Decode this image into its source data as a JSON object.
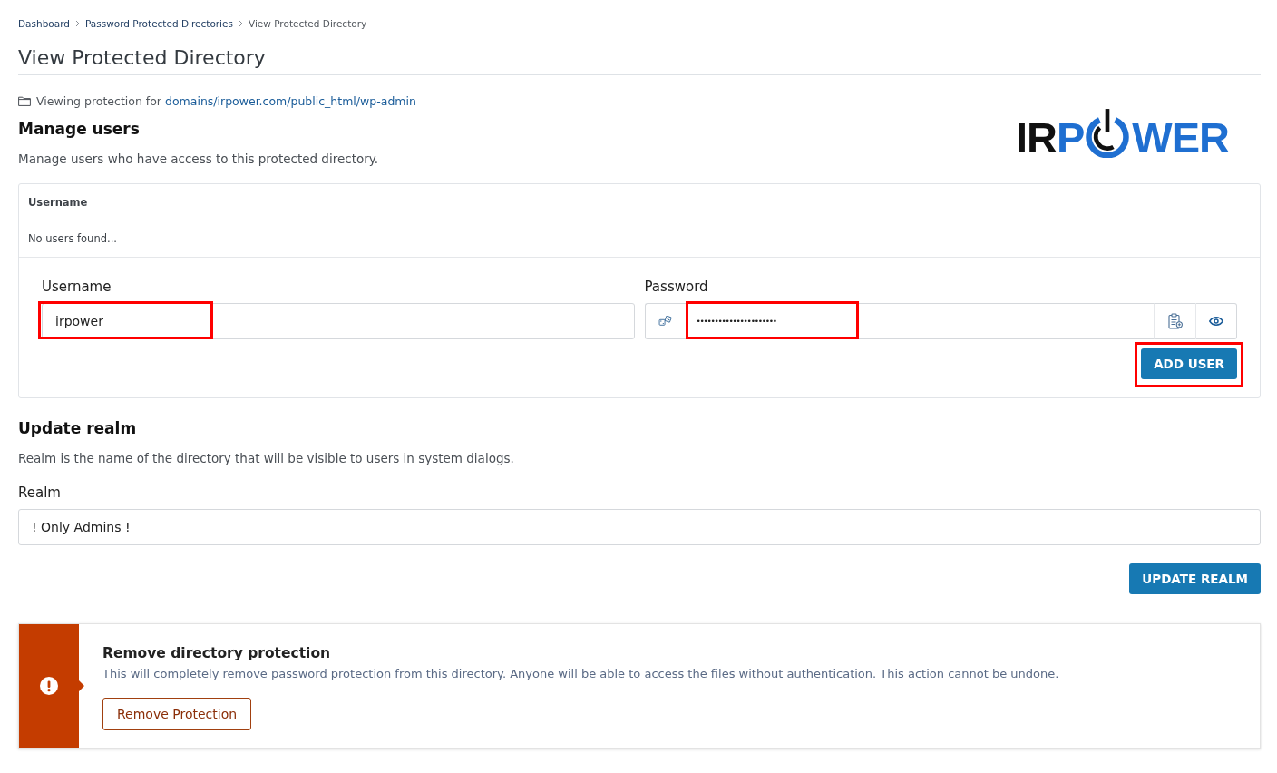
{
  "breadcrumb": [
    {
      "label": "Dashboard",
      "current": false
    },
    {
      "label": "Password Protected Directories",
      "current": false
    },
    {
      "label": "View Protected Directory",
      "current": true
    }
  ],
  "title": "View Protected Directory",
  "path_line": {
    "prefix": "Viewing protection for",
    "path": "domains/irpower.com/public_html/wp-admin"
  },
  "logo": {
    "segments": [
      {
        "kind": "text",
        "text": "IR",
        "color": "#111111"
      },
      {
        "kind": "text",
        "text": "P",
        "color": "#1f6fd1"
      },
      {
        "kind": "power"
      },
      {
        "kind": "text",
        "text": "WER",
        "color": "#1f6fd1"
      }
    ]
  },
  "manage_users": {
    "heading": "Manage users",
    "description": "Manage users who have access to this protected directory.",
    "table": {
      "columns": [
        "Username"
      ],
      "empty_message": "No users found..."
    },
    "form": {
      "username": {
        "label": "Username",
        "value": "irpower",
        "highlighted": true
      },
      "password": {
        "label": "Password",
        "value": "••••••••••••••••••••••",
        "highlighted": true
      },
      "add_button": {
        "label": "ADD USER",
        "highlighted": true
      }
    }
  },
  "update_realm": {
    "heading": "Update realm",
    "description": "Realm is the name of the directory that will be visible to users in system dialogs.",
    "field": {
      "label": "Realm",
      "value": "! Only Admins !"
    },
    "button": {
      "label": "UPDATE REALM"
    }
  },
  "danger_alert": {
    "title": "Remove directory protection",
    "message": "This will completely remove password protection from this directory. Anyone will be able to access the files without authentication. This action cannot be undone.",
    "button": {
      "label": "Remove Protection"
    }
  }
}
